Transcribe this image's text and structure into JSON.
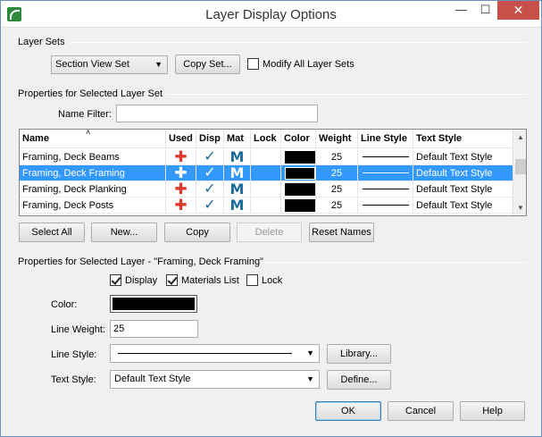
{
  "window": {
    "title": "Layer Display Options",
    "min_glyph": "—",
    "max_glyph": "☐",
    "close_glyph": "✕"
  },
  "layer_sets": {
    "group_label": "Layer Sets",
    "selected": "Section View Set",
    "copy_set_label": "Copy Set...",
    "modify_all_label": "Modify All Layer Sets",
    "modify_all_checked": false
  },
  "properties_set": {
    "group_label": "Properties for Selected Layer Set",
    "name_filter_label": "Name Filter:",
    "name_filter_value": ""
  },
  "table": {
    "headers": [
      "Name",
      "Used",
      "Disp",
      "Mat",
      "Lock",
      "Color",
      "Weight",
      "Line Style",
      "Text Style"
    ],
    "rows": [
      {
        "name": "Framing, Deck Beams",
        "used": "✚",
        "disp": "✓",
        "mat": "M",
        "weight": "25",
        "text_style": "Default Text Style",
        "selected": false
      },
      {
        "name": "Framing, Deck Framing",
        "used": "✚",
        "disp": "✓",
        "mat": "M",
        "weight": "25",
        "text_style": "Default Text Style",
        "selected": true
      },
      {
        "name": "Framing, Deck Planking",
        "used": "✚",
        "disp": "✓",
        "mat": "M",
        "weight": "25",
        "text_style": "Default Text Style",
        "selected": false
      },
      {
        "name": "Framing, Deck Posts",
        "used": "✚",
        "disp": "✓",
        "mat": "M",
        "weight": "25",
        "text_style": "Default Text Style",
        "selected": false
      }
    ],
    "sort_glyph": "˄",
    "scroll_up": "▲",
    "scroll_down": "▼"
  },
  "table_buttons": {
    "select_all": "Select All",
    "new": "New...",
    "copy": "Copy",
    "delete": "Delete",
    "reset_names": "Reset Names"
  },
  "properties_layer": {
    "group_label": "Properties for Selected Layer - \"Framing, Deck Framing\"",
    "display_label": "Display",
    "display_checked": true,
    "materials_label": "Materials List",
    "materials_checked": true,
    "lock_label": "Lock",
    "lock_checked": false,
    "color_label": "Color:",
    "color_value": "#000000",
    "line_weight_label": "Line Weight:",
    "line_weight_value": "25",
    "line_style_label": "Line Style:",
    "library_label": "Library...",
    "text_style_label": "Text Style:",
    "text_style_value": "Default Text Style",
    "define_label": "Define..."
  },
  "footer": {
    "ok": "OK",
    "cancel": "Cancel",
    "help": "Help"
  },
  "combo_arrow": "▼",
  "colors": {
    "selection": "#3399ff",
    "used_cross": "#e03a2f",
    "check": "#1d6a93",
    "close_button": "#c7504b"
  }
}
